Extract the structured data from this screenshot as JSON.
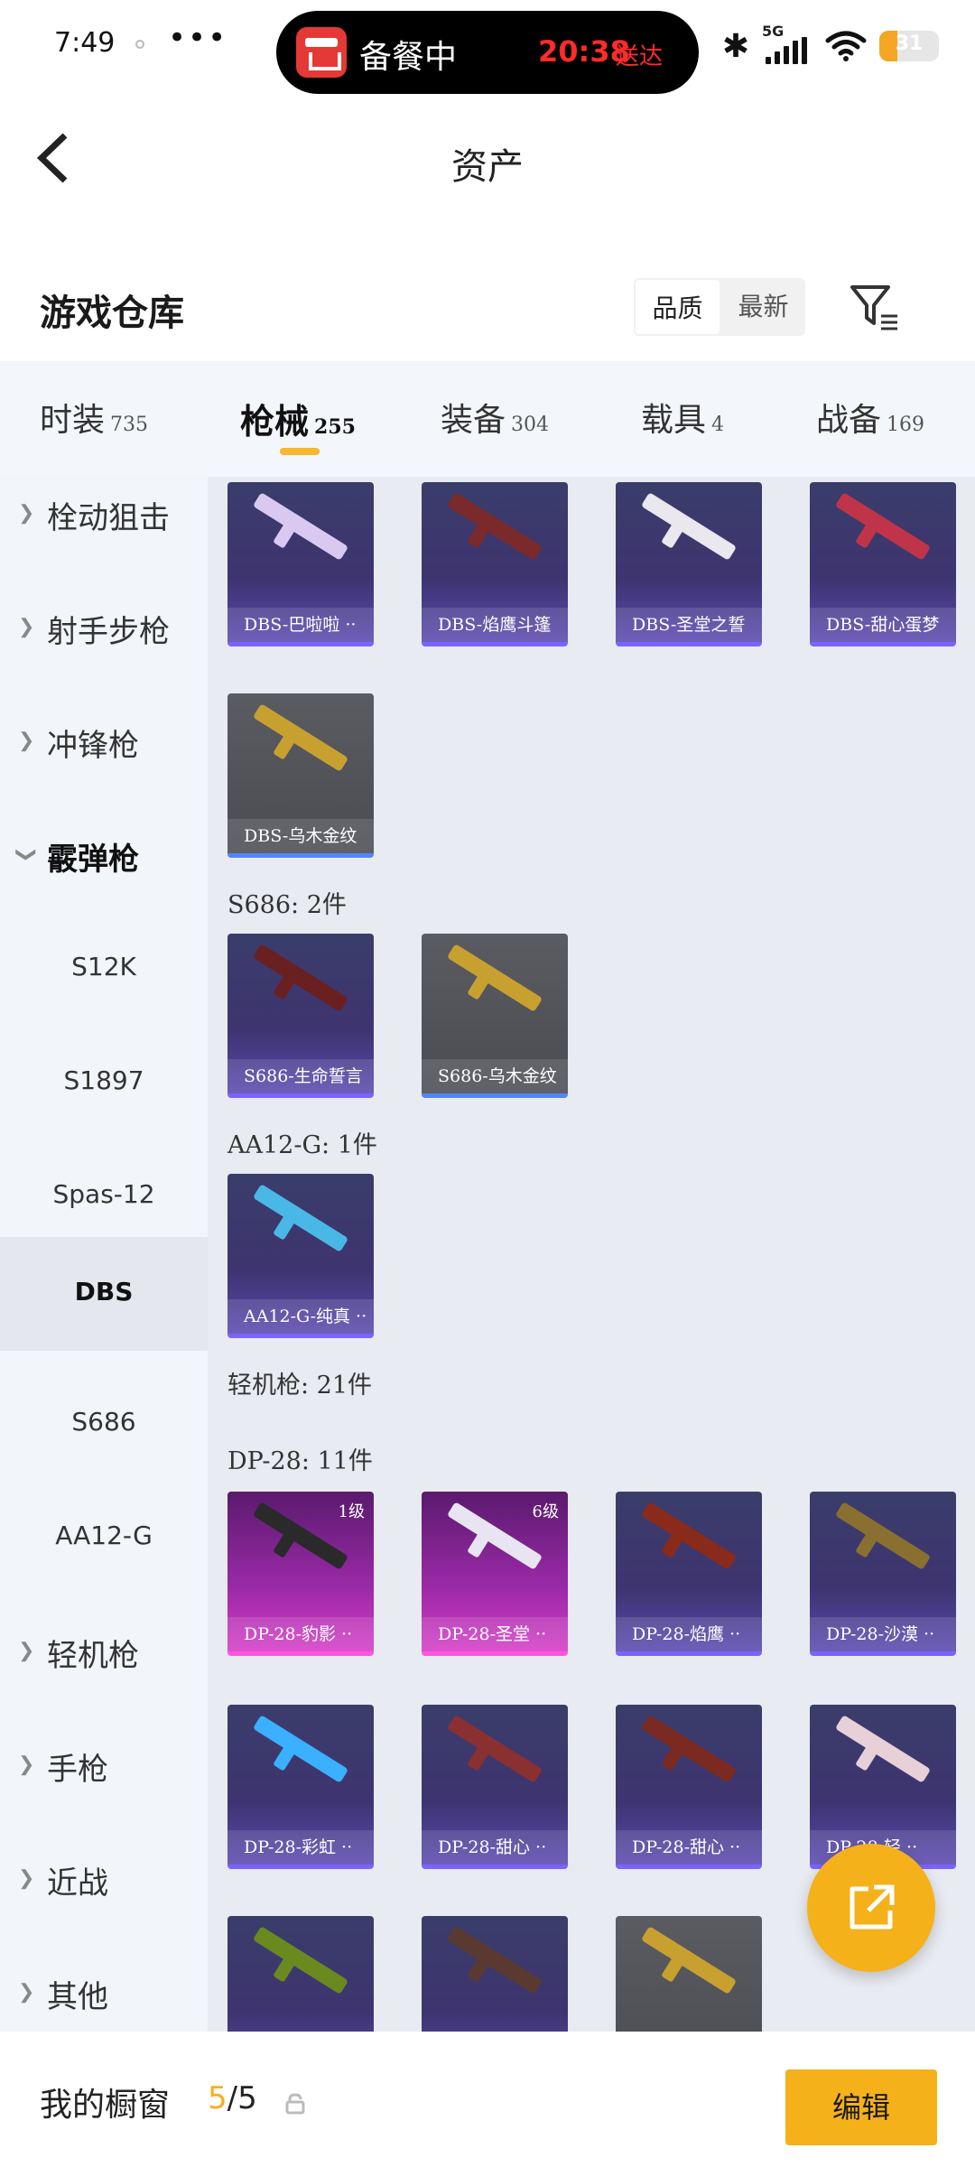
{
  "status_bar": {
    "time": "7:49",
    "more": "•••",
    "island_text": "备餐中",
    "island_time": "20:38",
    "island_sub": "送达",
    "network": "5G",
    "battery": "31",
    "battery_level": 0.31
  },
  "header": {
    "title": "资产"
  },
  "warehouse": {
    "title": "游戏仓库",
    "sort": [
      "品质",
      "最新"
    ]
  },
  "tabs": [
    {
      "label": "时装",
      "count": "735"
    },
    {
      "label": "枪械",
      "count": "255"
    },
    {
      "label": "装备",
      "count": "304"
    },
    {
      "label": "载具",
      "count": "4"
    },
    {
      "label": "战备",
      "count": "169"
    }
  ],
  "sidebar": [
    {
      "label": "栓动狙击",
      "type": "category"
    },
    {
      "label": "射手步枪",
      "type": "category"
    },
    {
      "label": "冲锋枪",
      "type": "category"
    },
    {
      "label": "霰弹枪",
      "type": "category-open"
    },
    {
      "label": "S12K",
      "type": "sub"
    },
    {
      "label": "S1897",
      "type": "sub"
    },
    {
      "label": "Spas-12",
      "type": "sub"
    },
    {
      "label": "DBS",
      "type": "sub-selected"
    },
    {
      "label": "S686",
      "type": "sub"
    },
    {
      "label": "AA12-G",
      "type": "sub"
    },
    {
      "label": "轻机枪",
      "type": "category"
    },
    {
      "label": "手枪",
      "type": "category"
    },
    {
      "label": "近战",
      "type": "category"
    },
    {
      "label": "其他",
      "type": "category"
    }
  ],
  "groups": [
    {
      "label": "S686: 2件"
    },
    {
      "label": "AA12-G: 1件"
    },
    {
      "label": "轻机枪: 21件"
    },
    {
      "label": "DP-28: 11件"
    }
  ],
  "items": [
    {
      "name": "DBS-巴啦啦 ··",
      "style": "purple",
      "gun_color": "#d9c8f0"
    },
    {
      "name": "DBS-焰鹰斗篷",
      "style": "purple",
      "gun_color": "#7a2a2a"
    },
    {
      "name": "DBS-圣堂之誓",
      "style": "purple",
      "gun_color": "#eae8ee"
    },
    {
      "name": "DBS-甜心蛋梦",
      "style": "purple",
      "gun_color": "#c0344a"
    },
    {
      "name": "DBS-乌木金纹",
      "style": "gray",
      "gun_color": "#c8a030"
    },
    {
      "name": "S686-生命誓言",
      "style": "purple",
      "gun_color": "#6a2020"
    },
    {
      "name": "S686-乌木金纹",
      "style": "gray",
      "gun_color": "#c8a030"
    },
    {
      "name": "AA12-G-纯真 ··",
      "style": "purple",
      "gun_color": "#4ab8e6"
    },
    {
      "name": "DP-28-豹影 ··",
      "style": "pink",
      "gun_color": "#2a2a2a",
      "level": "1级"
    },
    {
      "name": "DP-28-圣堂 ··",
      "style": "pink",
      "gun_color": "#e8e4f2",
      "level": "6级"
    },
    {
      "name": "DP-28-焰鹰 ··",
      "style": "purple",
      "gun_color": "#8a2a1a"
    },
    {
      "name": "DP-28-沙漠 ··",
      "style": "purple",
      "gun_color": "#8a7030"
    },
    {
      "name": "DP-28-彩虹 ··",
      "style": "purple",
      "gun_color": "#3ab0ff"
    },
    {
      "name": "DP-28-甜心 ··",
      "style": "purple",
      "gun_color": "#8a3030"
    },
    {
      "name": "DP-28-甜心 ··",
      "style": "purple",
      "gun_color": "#7a2a20"
    },
    {
      "name": "DP-28-轻 ··",
      "style": "purple",
      "gun_color": "#e8d0d8"
    },
    {
      "name": "",
      "style": "purple",
      "gun_color": "#6a8a20"
    },
    {
      "name": "",
      "style": "purple",
      "gun_color": "#5a3a30"
    },
    {
      "name": "",
      "style": "gray",
      "gun_color": "#c8a030"
    }
  ],
  "bottom": {
    "label": "我的橱窗",
    "count_current": "5",
    "count_total": "/5",
    "edit": "编辑"
  }
}
